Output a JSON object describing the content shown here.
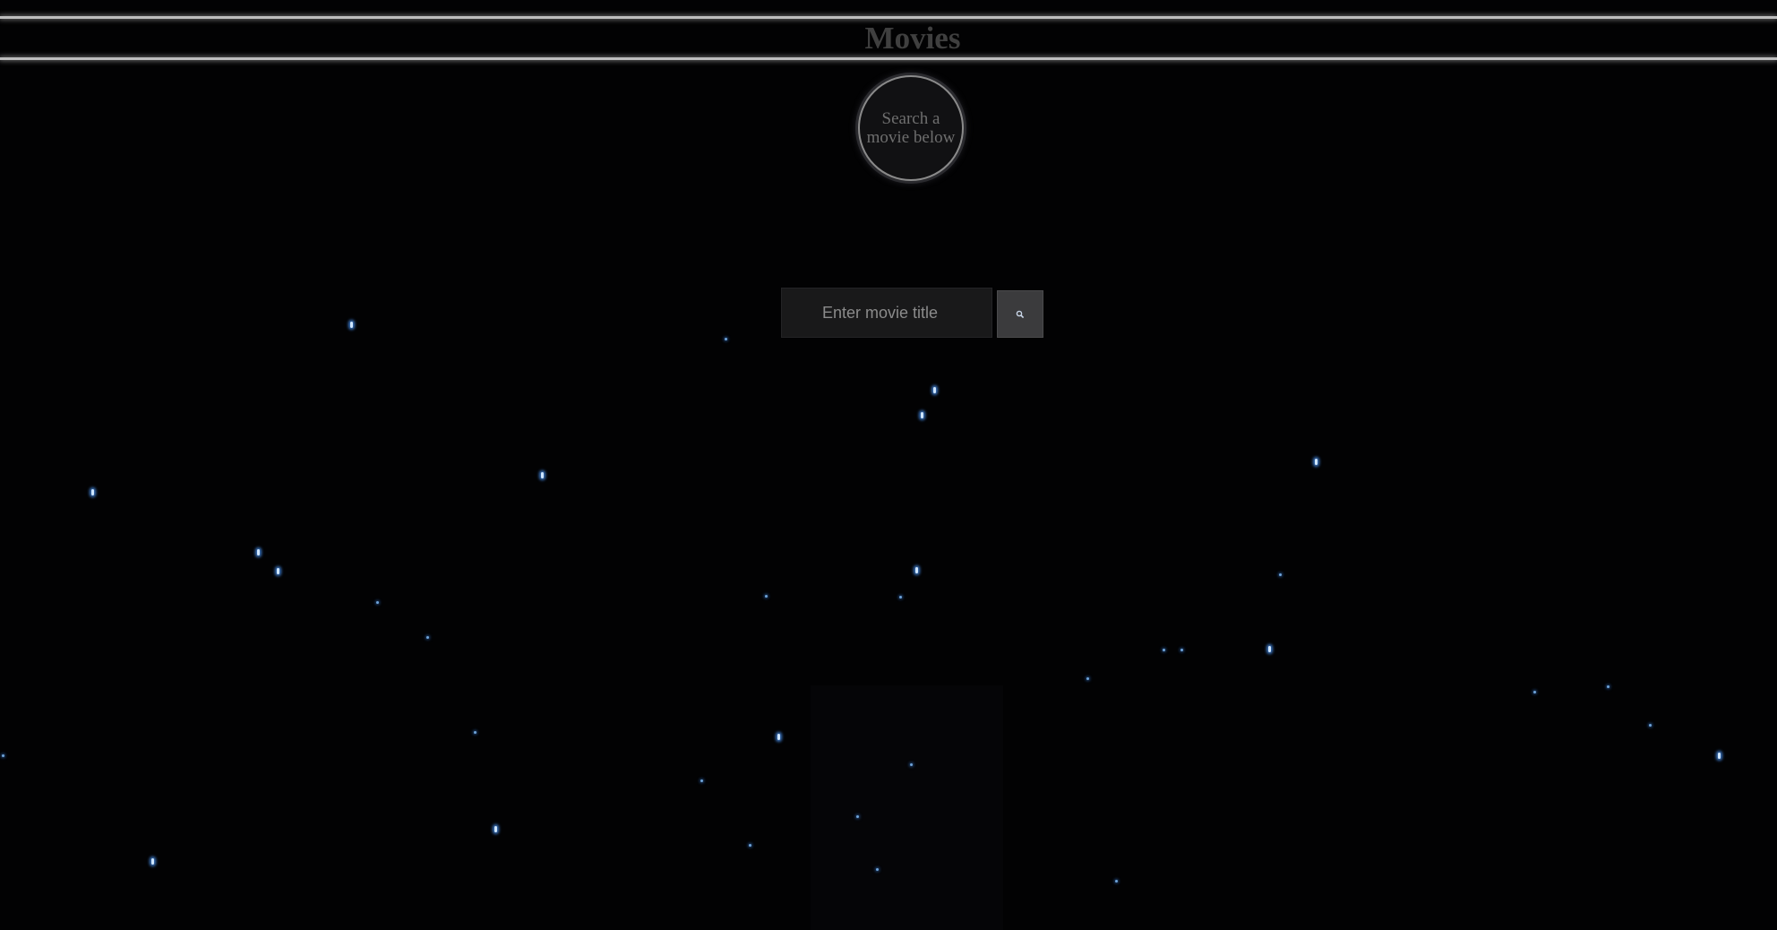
{
  "header": {
    "title": "Movies"
  },
  "subtitle": {
    "text": "Search a movie below"
  },
  "search": {
    "placeholder": "Enter movie title",
    "value": "",
    "button_icon": "search-icon"
  },
  "colors": {
    "background": "#020203",
    "header_line": "#bdbdbd",
    "title_text": "#3f3f3f",
    "input_background": "#19191a",
    "button_background": "#3b3b3d",
    "star_glow": "#468ce6"
  }
}
